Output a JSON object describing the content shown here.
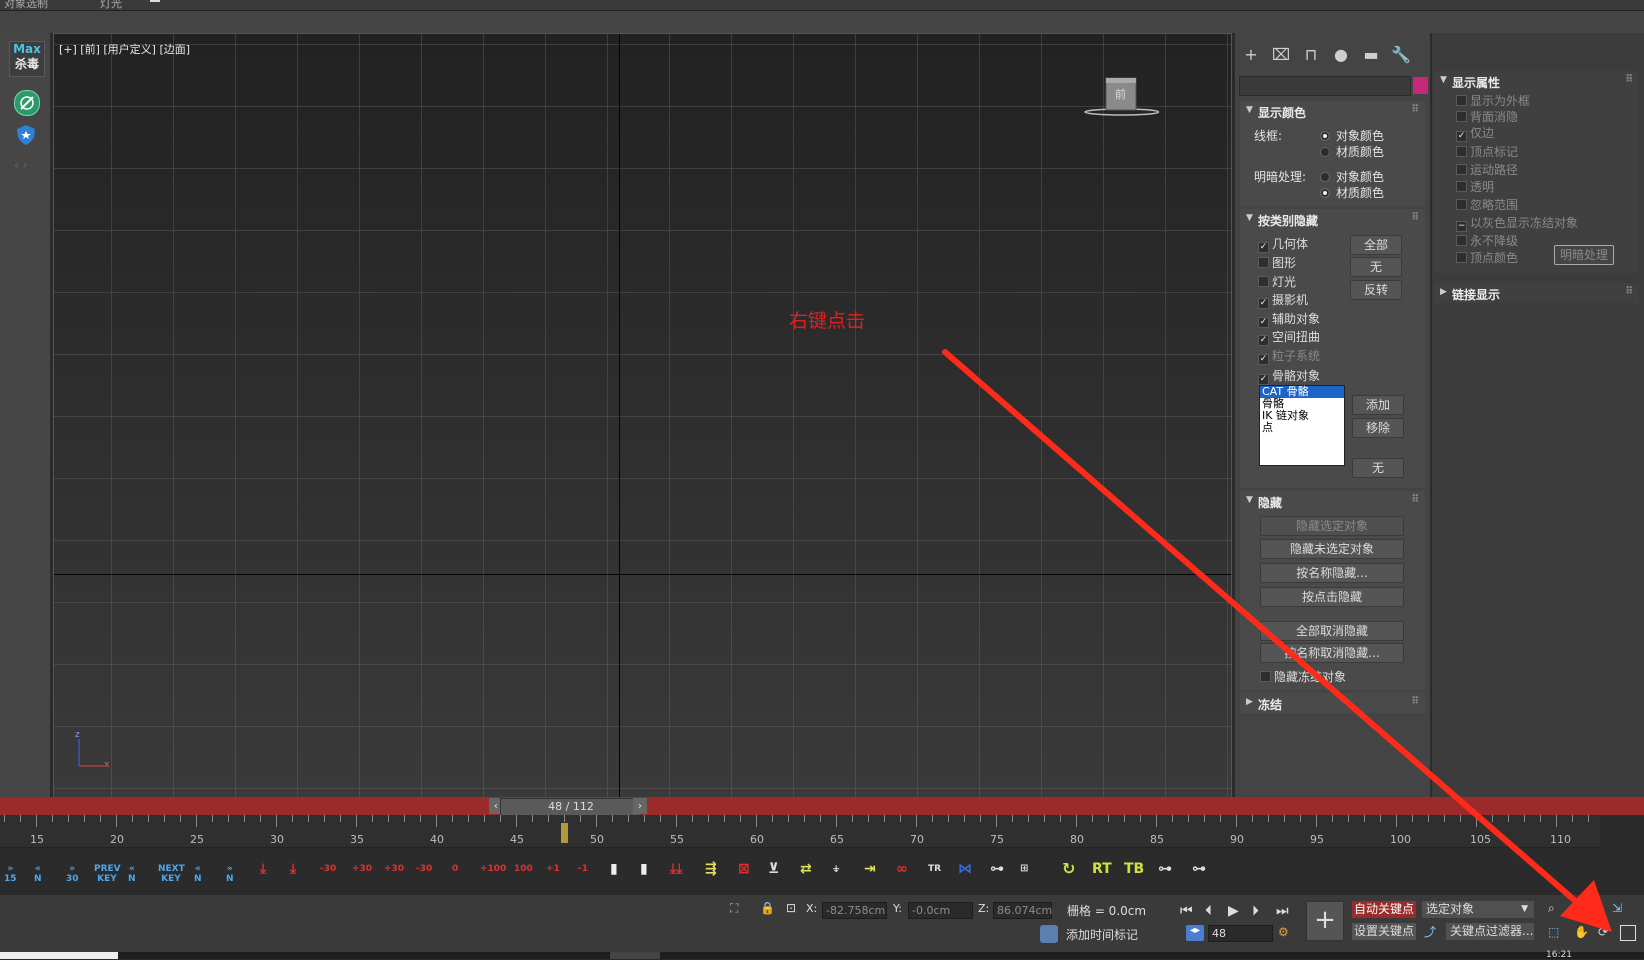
{
  "top": {
    "items": [
      "对象选制",
      "灯光"
    ]
  },
  "left_toolbar": {
    "logo_line1": "Max",
    "logo_line2": "杀毒",
    "icons": [
      "antivirus-icon",
      "shield-icon"
    ]
  },
  "viewport": {
    "label": "[+] [前] [用户定义] [边面]",
    "annotation": "右键点击",
    "navcube_face": "前",
    "axis_labels": {
      "y": "z",
      "x": "x"
    }
  },
  "command_panel": {
    "tabs": [
      "create-icon",
      "modify-icon",
      "hierarchy-icon",
      "motion-icon",
      "display-icon",
      "utilities-icon"
    ],
    "color_swatch": "#c8287a",
    "display_color": {
      "title": "显示颜色",
      "wireframe_label": "线框:",
      "wireframe_options": [
        "对象颜色",
        "材质颜色"
      ],
      "wireframe_selected": 0,
      "shaded_label": "明暗处理:",
      "shaded_options": [
        "对象颜色",
        "材质颜色"
      ],
      "shaded_selected": 1
    },
    "hide_by_category": {
      "title": "按类别隐藏",
      "items": [
        {
          "label": "几何体",
          "checked": true,
          "enabled": true
        },
        {
          "label": "图形",
          "checked": false,
          "enabled": true
        },
        {
          "label": "灯光",
          "checked": false,
          "enabled": true
        },
        {
          "label": "摄影机",
          "checked": true,
          "enabled": true
        },
        {
          "label": "辅助对象",
          "checked": true,
          "enabled": true
        },
        {
          "label": "空间扭曲",
          "checked": true,
          "enabled": true
        },
        {
          "label": "粒子系统",
          "checked": true,
          "enabled": false
        },
        {
          "label": "骨骼对象",
          "checked": true,
          "enabled": true
        }
      ],
      "buttons": [
        "全部",
        "无",
        "反转"
      ],
      "list": [
        "CAT 骨骼",
        "骨骼",
        "IK 链对象",
        "点"
      ],
      "list_selected": 0,
      "list_buttons": [
        "添加",
        "移除",
        "无"
      ]
    },
    "hide": {
      "title": "隐藏",
      "buttons": [
        "隐藏选定对象",
        "隐藏未选定对象",
        "按名称隐藏...",
        "按点击隐藏",
        "全部取消隐藏",
        "按名称取消隐藏..."
      ],
      "freeze_hidden": "隐藏冻结对象"
    },
    "freeze": {
      "title": "冻结"
    }
  },
  "display_properties": {
    "title": "显示属性",
    "items": [
      {
        "label": "显示为外框",
        "checked": false
      },
      {
        "label": "背面消隐",
        "checked": false
      },
      {
        "label": "仅边",
        "checked": true
      },
      {
        "label": "顶点标记",
        "checked": false
      },
      {
        "label": "运动路径",
        "checked": false
      },
      {
        "label": "透明",
        "checked": false
      },
      {
        "label": "忽略范围",
        "checked": false
      },
      {
        "label": "以灰色显示冻结对象",
        "checked": false
      },
      {
        "label": "永不降级",
        "checked": false
      },
      {
        "label": "顶点颜色",
        "checked": false
      }
    ],
    "shade_button": "明暗处理",
    "link_display": "链接显示"
  },
  "timeline": {
    "scrubber": "48 / 112",
    "current_frame": 48,
    "ruler_labels": [
      "15",
      "20",
      "25",
      "30",
      "35",
      "40",
      "45",
      "50",
      "55",
      "60",
      "65",
      "70",
      "75",
      "80",
      "85",
      "90",
      "95",
      "100",
      "105",
      "110"
    ]
  },
  "key_tools": [
    "15",
    "N",
    "30",
    "PREV KEY",
    "N",
    "NEXT KEY",
    "N",
    "N",
    "-30",
    "+30",
    "+30",
    "-30",
    "0",
    "+100",
    "100",
    "+1",
    "-1",
    "TR",
    "RT",
    "TB"
  ],
  "status": {
    "x_label": "X:",
    "x_value": "-82.758cm",
    "y_label": "Y:",
    "y_value": "-0.0cm",
    "z_label": "Z:",
    "z_value": "86.074cm",
    "grid_label": "栅格 = 0.0cm",
    "add_time_tag": "添加时间标记",
    "auto_key": "自动关键点",
    "set_key": "设置关键点",
    "selected_object": "选定对象",
    "key_filter": "关键点过滤器...",
    "frame_field": "48",
    "clock": "16:21"
  },
  "colors": {
    "accent_red": "#9b2a2a",
    "annotation_red": "#ff2a1a",
    "selection_blue": "#1c64c8"
  }
}
